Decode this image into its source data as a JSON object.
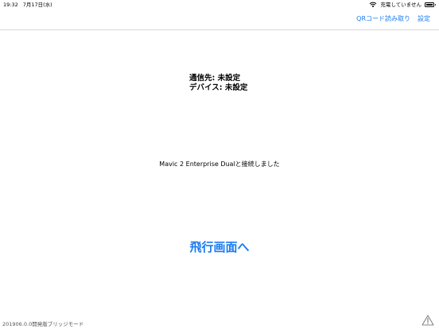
{
  "status_bar": {
    "time": "19:32",
    "date": "7月17日(水)",
    "charging_text": "充電していません",
    "wifi_icon": "wifi-icon",
    "battery_icon": "battery-icon"
  },
  "nav": {
    "qr_read": "QRコード読み取り",
    "settings": "設定",
    "accent_color": "#1a7cf2"
  },
  "connection": {
    "destination": "通信先: 未設定",
    "device": "デバイス: 未設定"
  },
  "connected_message": "Mavic 2 Enterprise Dualと接続しました",
  "fly_button": "飛行画面へ",
  "footer": {
    "version": "201906.0.0開発版ブリッジモード",
    "warning_icon": "warning-icon"
  }
}
